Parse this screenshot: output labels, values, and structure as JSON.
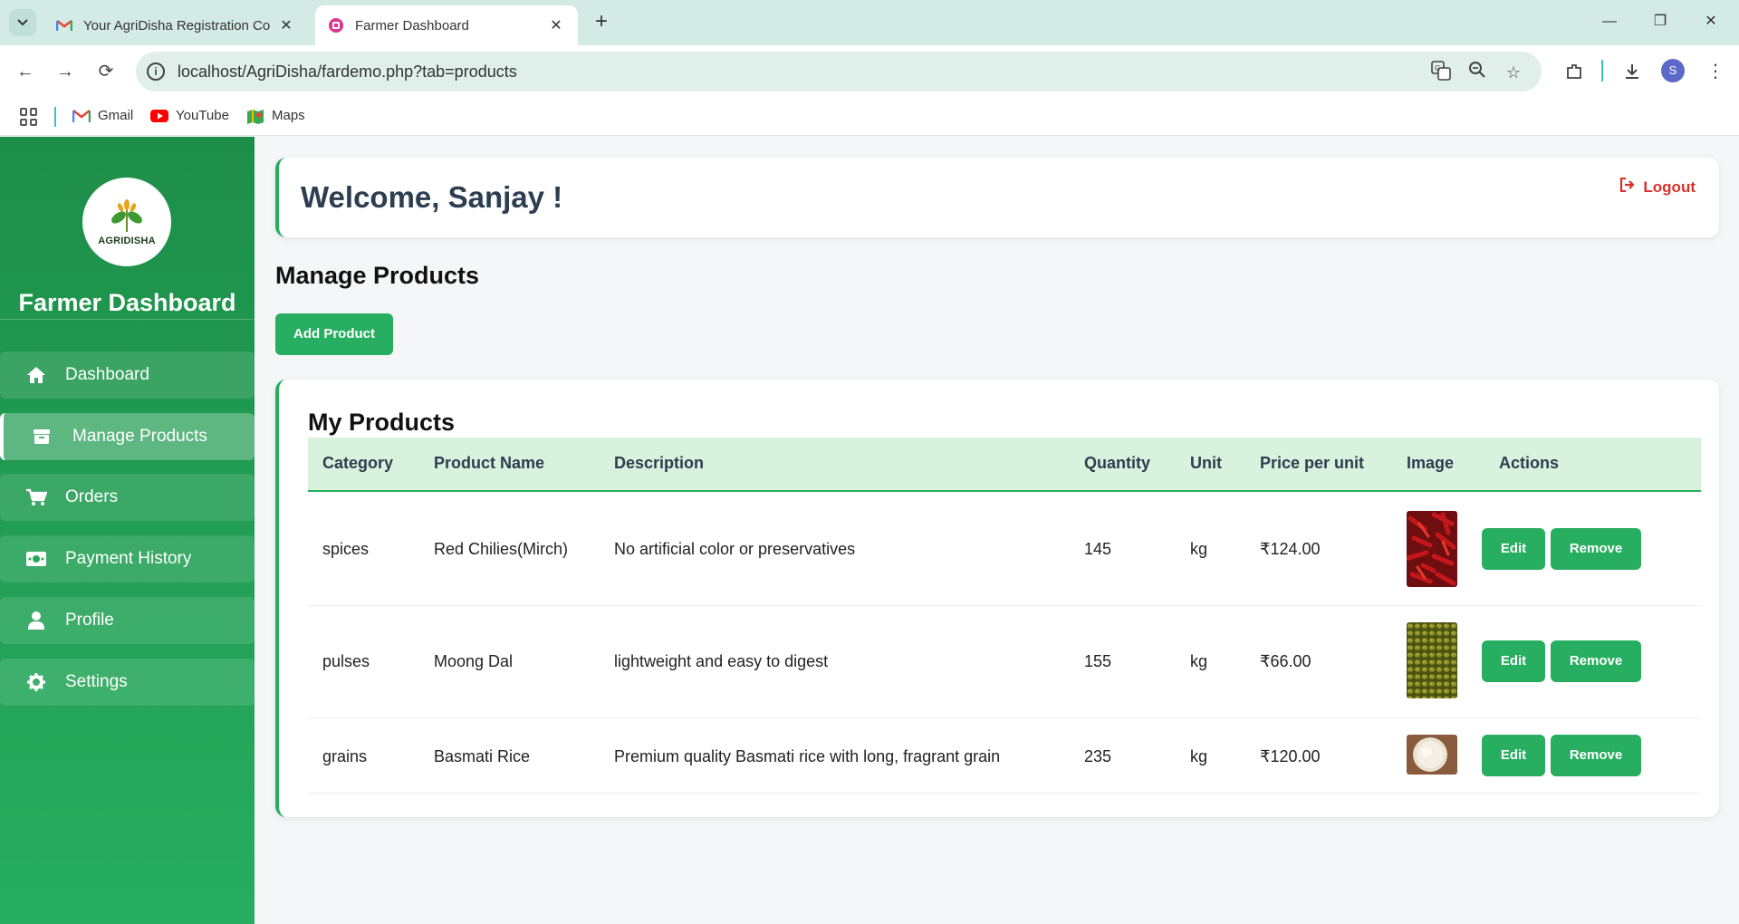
{
  "browser": {
    "tabs": [
      {
        "title": "Your AgriDisha Registration Co",
        "icon": "gmail-icon"
      },
      {
        "title": "Farmer Dashboard",
        "icon": "site-icon"
      }
    ],
    "url": "localhost/AgriDisha/fardemo.php?tab=products",
    "profile_initial": "S",
    "bookmarks": [
      {
        "label": "Gmail",
        "icon": "gmail-icon"
      },
      {
        "label": "YouTube",
        "icon": "youtube-icon"
      },
      {
        "label": "Maps",
        "icon": "maps-icon"
      }
    ]
  },
  "sidebar": {
    "logo_text": "AGRIDISHA",
    "title": "Farmer Dashboard",
    "items": [
      {
        "label": "Dashboard",
        "icon": "home-icon"
      },
      {
        "label": "Manage Products",
        "icon": "box-icon",
        "active": true
      },
      {
        "label": "Orders",
        "icon": "cart-icon"
      },
      {
        "label": "Payment History",
        "icon": "money-icon"
      },
      {
        "label": "Profile",
        "icon": "user-icon"
      },
      {
        "label": "Settings",
        "icon": "gear-icon"
      }
    ]
  },
  "header": {
    "welcome": "Welcome, Sanjay !",
    "logout": "Logout"
  },
  "main": {
    "section_title": "Manage Products",
    "add_button": "Add Product",
    "card_title": "My Products",
    "columns": [
      "Category",
      "Product Name",
      "Description",
      "Quantity",
      "Unit",
      "Price per unit",
      "Image",
      "Actions"
    ],
    "rows": [
      {
        "category": "spices",
        "name": "Red Chilies(Mirch)",
        "description": "No artificial color or preservatives",
        "quantity": "145",
        "unit": "kg",
        "price": "₹124.00",
        "image": "red-chilies-image"
      },
      {
        "category": "pulses",
        "name": "Moong Dal",
        "description": "lightweight and easy to digest",
        "quantity": "155",
        "unit": "kg",
        "price": "₹66.00",
        "image": "moong-dal-image"
      },
      {
        "category": "grains",
        "name": "Basmati Rice",
        "description": "Premium quality Basmati rice with long, fragrant grain",
        "quantity": "235",
        "unit": "kg",
        "price": "₹120.00",
        "image": "basmati-rice-image"
      }
    ],
    "edit_label": "Edit",
    "remove_label": "Remove"
  },
  "colors": {
    "primary_green": "#27ae60",
    "sidebar_dark_green": "#1d8e48",
    "table_header_bg": "#d9f2dd",
    "logout_red": "#d9302c"
  }
}
